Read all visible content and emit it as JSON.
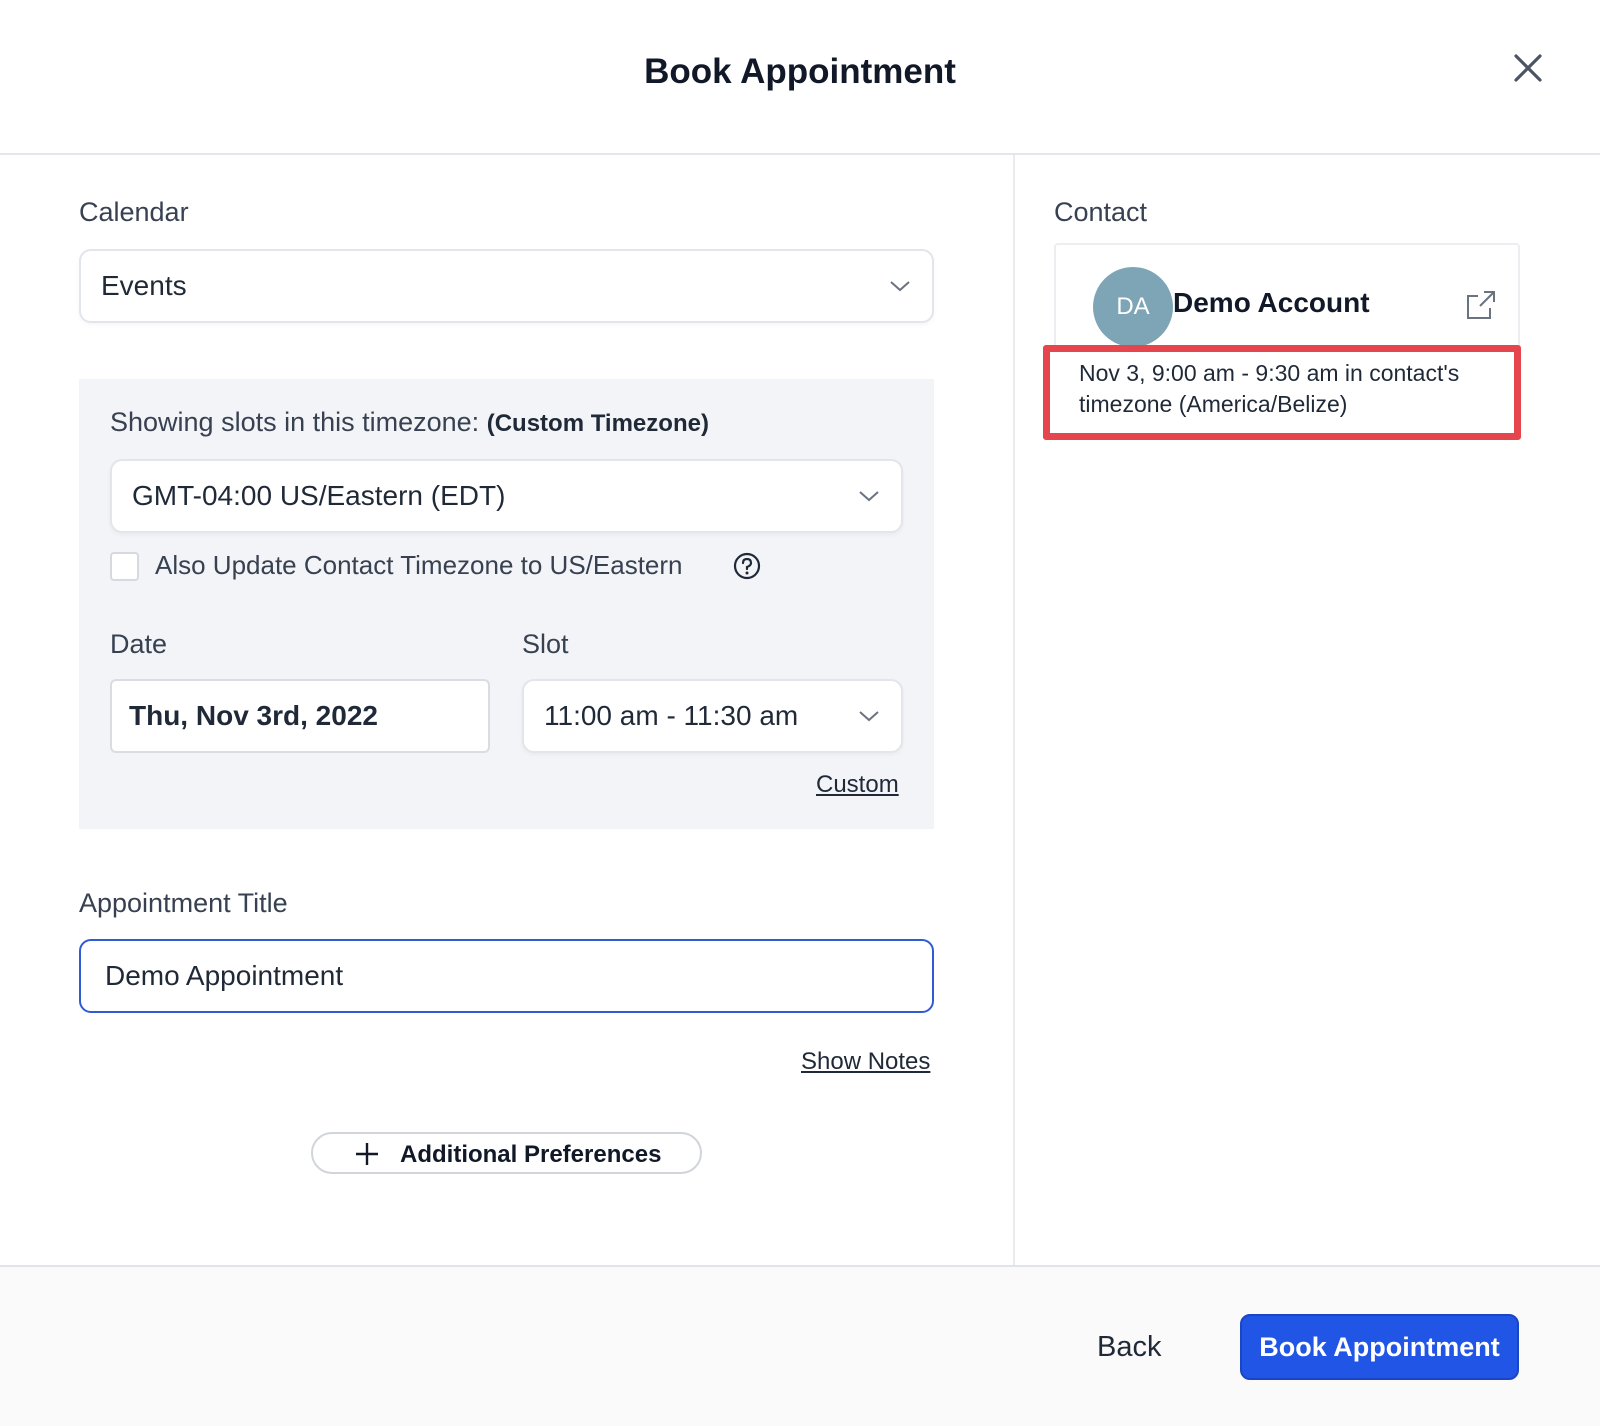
{
  "modal": {
    "title": "Book Appointment",
    "close_icon": "close-icon"
  },
  "form": {
    "calendar_label": "Calendar",
    "calendar_value": "Events",
    "timezone_label": "Showing slots in this timezone:",
    "timezone_tag": "(Custom Timezone)",
    "timezone_value": "GMT-04:00 US/Eastern (EDT)",
    "update_tz_label": "Also Update Contact Timezone to US/Eastern",
    "update_tz_checked": false,
    "date_label": "Date",
    "date_value": "Thu, Nov 3rd, 2022",
    "slot_label": "Slot",
    "slot_value": "11:00 am - 11:30 am",
    "custom_link": "Custom",
    "title_label": "Appointment Title",
    "title_value": "Demo Appointment",
    "show_notes_link": "Show Notes",
    "additional_prefs_label": "Additional Preferences"
  },
  "contact": {
    "section_label": "Contact",
    "initials": "DA",
    "name": "Demo Account",
    "slot_info": "Nov 3, 9:00 am - 9:30 am in contact's timezone (America/Belize)"
  },
  "footer": {
    "back_label": "Back",
    "book_label": "Book Appointment"
  },
  "colors": {
    "primary": "#2055e5",
    "highlight": "#e5464e",
    "avatar": "#7ea5b5",
    "panel_bg": "#f3f4f7"
  }
}
